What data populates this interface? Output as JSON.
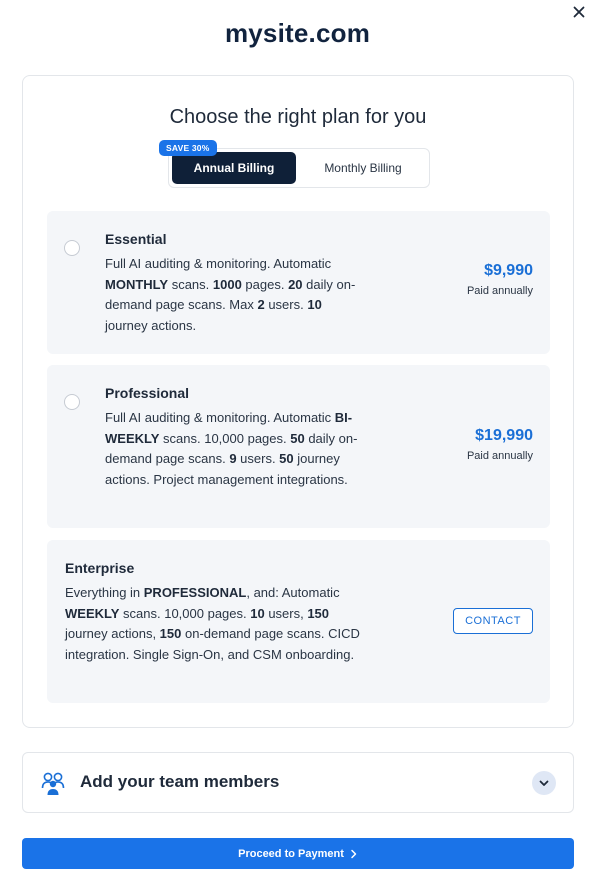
{
  "header": {
    "site_title": "mysite.com",
    "close_icon": "close-icon"
  },
  "plans": {
    "heading": "Choose the right plan for you",
    "billing": {
      "annual_label": "Annual Billing",
      "monthly_label": "Monthly Billing",
      "save_badge": "SAVE 30%",
      "selected": "annual"
    },
    "options": [
      {
        "name": "Essential",
        "description_parts": [
          {
            "text": "Full AI auditing & monitoring. Automatic ",
            "bold": false
          },
          {
            "text": "MONTHLY",
            "bold": true
          },
          {
            "text": " scans. ",
            "bold": false
          },
          {
            "text": "1000",
            "bold": true
          },
          {
            "text": " pages. ",
            "bold": false
          },
          {
            "text": "20",
            "bold": true
          },
          {
            "text": " daily on-demand page scans. Max ",
            "bold": false
          },
          {
            "text": "2",
            "bold": true
          },
          {
            "text": " users. ",
            "bold": false
          },
          {
            "text": "10",
            "bold": true
          },
          {
            "text": " journey actions.",
            "bold": false
          }
        ],
        "price": "$9,990",
        "price_note": "Paid annually"
      },
      {
        "name": "Professional",
        "description_parts": [
          {
            "text": "Full AI auditing & monitoring. Automatic ",
            "bold": false
          },
          {
            "text": "BI-WEEKLY",
            "bold": true
          },
          {
            "text": " scans. 10,000 pages. ",
            "bold": false
          },
          {
            "text": "50",
            "bold": true
          },
          {
            "text": " daily on-demand page scans. ",
            "bold": false
          },
          {
            "text": "9",
            "bold": true
          },
          {
            "text": " users. ",
            "bold": false
          },
          {
            "text": "50",
            "bold": true
          },
          {
            "text": " journey actions. Project management integrations.",
            "bold": false
          }
        ],
        "price": "$19,990",
        "price_note": "Paid annually"
      },
      {
        "name": "Enterprise",
        "description_parts": [
          {
            "text": "Everything in ",
            "bold": false
          },
          {
            "text": "PROFESSIONAL",
            "bold": true
          },
          {
            "text": ", and: Automatic ",
            "bold": false
          },
          {
            "text": "WEEKLY",
            "bold": true
          },
          {
            "text": " scans. 10,000 pages. ",
            "bold": false
          },
          {
            "text": "10",
            "bold": true
          },
          {
            "text": " users, ",
            "bold": false
          },
          {
            "text": "150",
            "bold": true
          },
          {
            "text": " journey actions, ",
            "bold": false
          },
          {
            "text": "150",
            "bold": true
          },
          {
            "text": " on-demand page scans. CICD integration. Single Sign-On, and CSM onboarding.",
            "bold": false
          }
        ],
        "contact_label": "CONTACT"
      }
    ]
  },
  "team": {
    "label": "Add your team members",
    "icon": "team-members-icon",
    "chevron_icon": "chevron-down-icon"
  },
  "footer": {
    "proceed_label": "Proceed to Payment",
    "proceed_icon": "chevron-right-icon"
  },
  "colors": {
    "primary": "#1a73e8",
    "navy": "#0f2038",
    "price_blue": "#1a6fd6",
    "option_bg": "#f4f6f9"
  }
}
